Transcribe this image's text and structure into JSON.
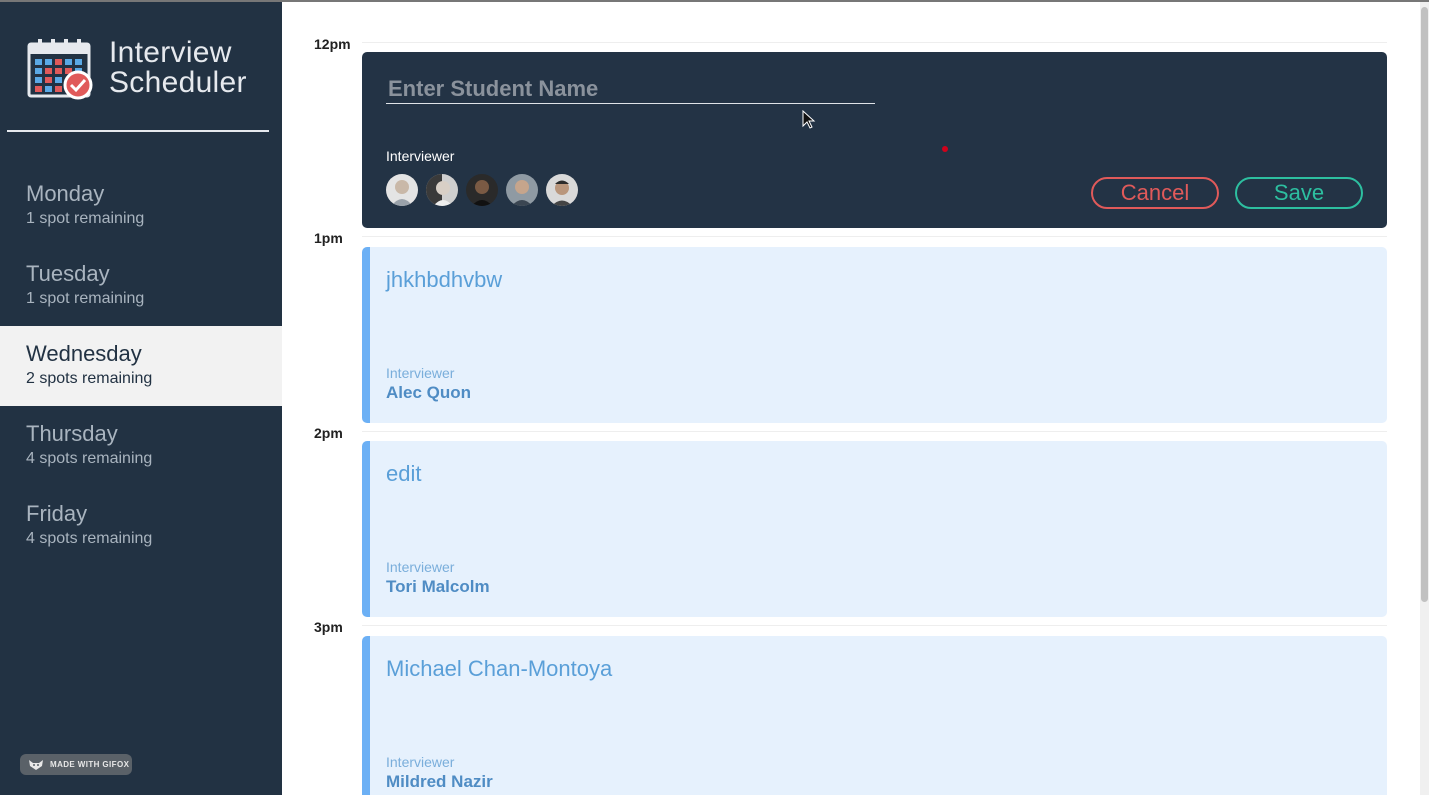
{
  "app": {
    "title_line1": "Interview",
    "title_line2": "Scheduler"
  },
  "sidebar": {
    "days": [
      {
        "name": "Monday",
        "spots": "1 spot remaining",
        "selected": false
      },
      {
        "name": "Tuesday",
        "spots": "1 spot remaining",
        "selected": false
      },
      {
        "name": "Wednesday",
        "spots": "2 spots remaining",
        "selected": true
      },
      {
        "name": "Thursday",
        "spots": "4 spots remaining",
        "selected": false
      },
      {
        "name": "Friday",
        "spots": "4 spots remaining",
        "selected": false
      }
    ],
    "badge": "MADE WITH GIFOX"
  },
  "schedule": {
    "times": [
      "12pm",
      "1pm",
      "2pm",
      "3pm"
    ],
    "form": {
      "student_placeholder": "Enter Student Name",
      "student_value": "",
      "interviewer_label": "Interviewer",
      "interviewer_count": 5,
      "cancel_label": "Cancel",
      "save_label": "Save"
    },
    "appointments": [
      {
        "student": "jhkhbdhvbw",
        "interviewer_label": "Interviewer",
        "interviewer": "Alec Quon"
      },
      {
        "student": "edit",
        "interviewer_label": "Interviewer",
        "interviewer": "Tori Malcolm"
      },
      {
        "student": "Michael Chan-Montoya",
        "interviewer_label": "Interviewer",
        "interviewer": "Mildred Nazir"
      }
    ]
  },
  "colors": {
    "sidebar_bg": "#223243",
    "form_bg": "#233345",
    "cancel": "#e05a5a",
    "save": "#2dbfa0",
    "appointment_bg": "#e6f1fd",
    "appointment_accent": "#6cb0f5"
  }
}
